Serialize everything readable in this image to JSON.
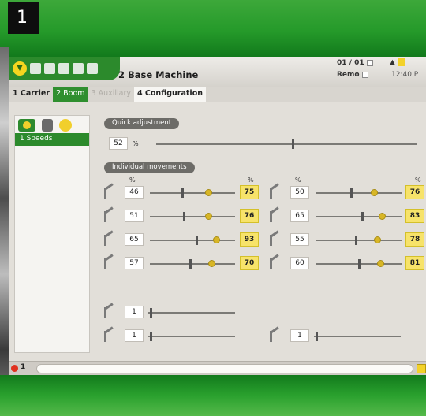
{
  "page_number": "1",
  "colors": {
    "brand_green": "#2c8a2c",
    "highlight_yellow": "#f7e36a",
    "alarm_red": "#e0301e"
  },
  "toolbar": {
    "icons": [
      "down-arrow-icon",
      "back-arrow-icon",
      "document-icon",
      "copy-icon",
      "save-icon",
      "operator-icon"
    ]
  },
  "window": {
    "title": "2 Base Machine"
  },
  "status": {
    "counter": "01 / 01",
    "mode": "Remo",
    "time": "12:40 P"
  },
  "tabs": [
    {
      "label": "1 Carrier",
      "state": "normal"
    },
    {
      "label": "2 Boom",
      "state": "active"
    },
    {
      "label": "3 Auxiliary",
      "state": "disabled"
    },
    {
      "label": "4 Configuration",
      "state": "current"
    }
  ],
  "sidebar": {
    "icons": [
      "speed-icon",
      "machine-icon",
      "oil-icon"
    ],
    "items": [
      {
        "label": "1 Speeds",
        "selected": true
      }
    ]
  },
  "quick": {
    "label": "Quick adjustment",
    "value": "52",
    "unit": "%",
    "level_percent": 52
  },
  "individual": {
    "label": "Individual movements",
    "pct_headers": [
      "%",
      "%",
      "%",
      "%"
    ],
    "left": [
      {
        "icon": "boom-lift-icon",
        "value": "46",
        "max": "75"
      },
      {
        "icon": "boom-lower-icon",
        "value": "51",
        "max": "76"
      },
      {
        "icon": "arm-out-icon",
        "value": "65",
        "max": "93"
      },
      {
        "icon": "arm-in-icon",
        "value": "57",
        "max": "70"
      }
    ],
    "right": [
      {
        "icon": "stick-out-icon",
        "value": "50",
        "max": "76"
      },
      {
        "icon": "stick-in-icon",
        "value": "65",
        "max": "83"
      },
      {
        "icon": "bucket-open-icon",
        "value": "55",
        "max": "78"
      },
      {
        "icon": "bucket-close-icon",
        "value": "60",
        "max": "81"
      }
    ]
  },
  "extra": [
    {
      "icon": "slew-left-icon",
      "value": "1"
    },
    {
      "icon": "slew-right-icon",
      "value": "1"
    },
    {
      "icon": "tilt-icon",
      "value": "1"
    }
  ],
  "bottom": {
    "alarm_count": "1",
    "message": ""
  }
}
